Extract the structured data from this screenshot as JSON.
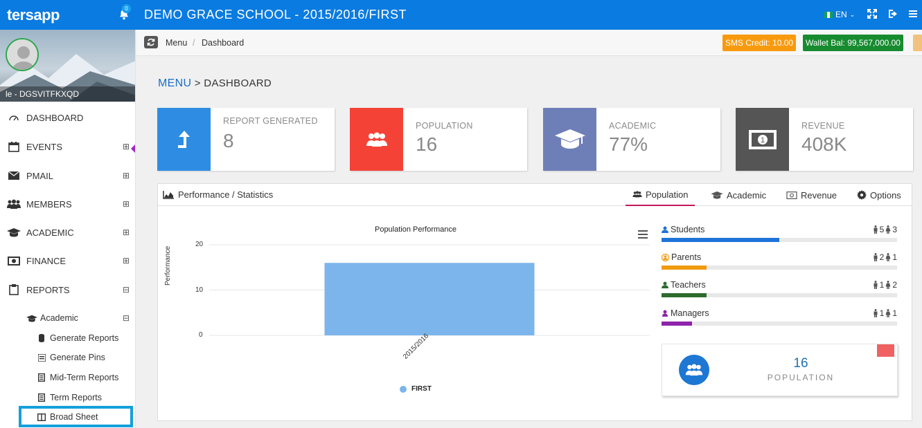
{
  "app": {
    "logo": "tersapp",
    "notification_count": "0",
    "school_title": "DEMO GRACE SCHOOL - 2015/2016/FIRST",
    "language": "EN"
  },
  "sidebar": {
    "username": "le - DGSVITFKXQD",
    "items": [
      {
        "label": "DASHBOARD",
        "icon": "gauge-icon"
      },
      {
        "label": "EVENTS",
        "icon": "calendar-icon",
        "toggle": "⊞"
      },
      {
        "label": "PMAIL",
        "icon": "envelope-icon",
        "toggle": "⊞"
      },
      {
        "label": "MEMBERS",
        "icon": "users-icon",
        "toggle": "⊞"
      },
      {
        "label": "ACADEMIC",
        "icon": "graduation-cap-icon",
        "toggle": "⊞"
      },
      {
        "label": "FINANCE",
        "icon": "money-icon",
        "toggle": "⊞"
      },
      {
        "label": "REPORTS",
        "icon": "clipboard-icon",
        "toggle": "⊟"
      }
    ],
    "sub_group": {
      "label": "Academic",
      "toggle": "⊟"
    },
    "sub_items": [
      {
        "label": "Generate Reports"
      },
      {
        "label": "Generate Pins"
      },
      {
        "label": "Mid-Term Reports"
      },
      {
        "label": "Term Reports"
      },
      {
        "label": "Broad Sheet"
      }
    ]
  },
  "breadcrumb": {
    "items": [
      "Menu",
      "Dashboard"
    ],
    "separator": "/"
  },
  "badges": {
    "sms_credit": "SMS Credit: 10.00",
    "wallet_balance": "Wallet Bal: 99,567,000.00"
  },
  "page_heading": {
    "menu": "MENU",
    "rest": " > DASHBOARD"
  },
  "cards": [
    {
      "label": "REPORT GENERATED",
      "value": "8",
      "color": "#2e8de3",
      "icon": "upload-arrow-icon"
    },
    {
      "label": "POPULATION",
      "value": "16",
      "color": "#f44336",
      "icon": "group-icon"
    },
    {
      "label": "ACADEMIC",
      "value": "77%",
      "color": "#6e7fb8",
      "icon": "graduation-cap-icon"
    },
    {
      "label": "REVENUE",
      "value": "408K",
      "color": "#555555",
      "icon": "banknote-icon"
    }
  ],
  "panel": {
    "title": "Performance / Statistics",
    "tabs": [
      "Population",
      "Academic",
      "Revenue",
      "Options"
    ],
    "active_tab": "Population"
  },
  "chart_data": {
    "type": "bar",
    "title": "Population Performance",
    "xlabel": "",
    "ylabel": "Performance",
    "categories": [
      "2015/2016"
    ],
    "series": [
      {
        "name": "FIRST",
        "values": [
          16
        ],
        "color": "#7cb5ec"
      }
    ],
    "ylim": [
      0,
      20
    ],
    "yticks": [
      "0",
      "10",
      "20"
    ],
    "legend": "bottom-center",
    "grid": true
  },
  "population_stats": [
    {
      "label": "Students",
      "male": "5",
      "female": "3",
      "fraction": 0.5,
      "color": "#1e73d8",
      "icon_color": "#1e73d8"
    },
    {
      "label": "Parents",
      "male": "2",
      "female": "1",
      "fraction": 0.19,
      "color": "#f09a0f",
      "icon_color": "#f09a0f"
    },
    {
      "label": "Teachers",
      "male": "1",
      "female": "2",
      "fraction": 0.19,
      "color": "#2e6b2e",
      "icon_color": "#2e6b2e"
    },
    {
      "label": "Managers",
      "male": "1",
      "female": "1",
      "fraction": 0.13,
      "color": "#8e24aa",
      "icon_color": "#8e24aa"
    }
  ],
  "population_summary": {
    "value": "16",
    "label": "POPULATION"
  }
}
